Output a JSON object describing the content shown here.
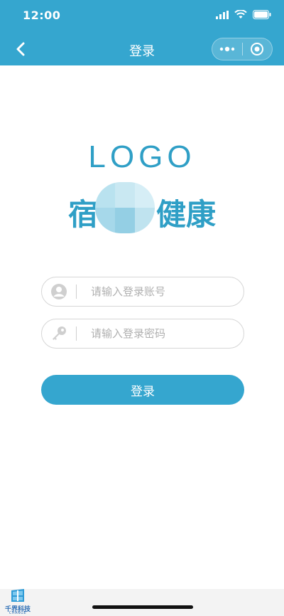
{
  "status_bar": {
    "time": "12:00"
  },
  "nav": {
    "title": "登录"
  },
  "logo": {
    "text": "LOGO",
    "brand_first": "宿",
    "brand_rest_1": "健",
    "brand_rest_2": "康"
  },
  "form": {
    "account_placeholder": "请输入登录账号",
    "password_placeholder": "请输入登录密码",
    "login_label": "登录"
  },
  "footer": {
    "company_name": "千界科技",
    "company_sub": "CHANGE"
  },
  "colors": {
    "primary": "#35a6cf",
    "logo": "#2f9fc6",
    "border": "#d6d6d6",
    "placeholder": "#b0b0b0"
  }
}
